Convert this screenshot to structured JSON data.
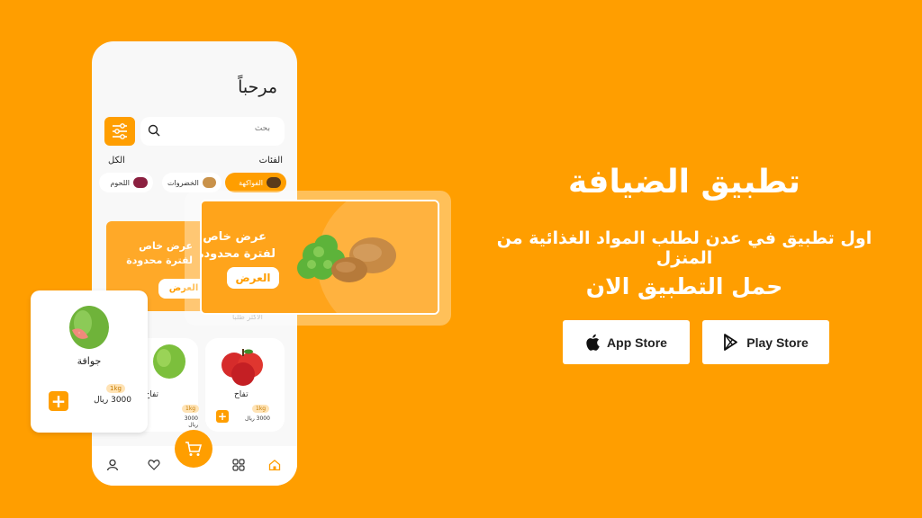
{
  "phone": {
    "greeting": "مرحباً",
    "search_placeholder": "بحث",
    "categories_title": "الفئات",
    "categories_all": "الكل",
    "categories": [
      "الفواكهة",
      "الخضروات",
      "اللحوم"
    ],
    "promo": {
      "line1": "عرض خاص",
      "line2": "لفترة محدودة",
      "button": "العرض"
    },
    "most_requested": "الأكثر طلباً",
    "products": [
      {
        "name": "تفاح",
        "unit": "1kg",
        "price": "3000 ريال"
      },
      {
        "name": "تفاح",
        "unit": "1kg",
        "price": "3000 ريال"
      }
    ]
  },
  "floating_promo": {
    "line1": "عرض خاص",
    "line2": "لفترة محدودة",
    "button": "العرض"
  },
  "floating_product": {
    "name": "جوافة",
    "unit": "1kg",
    "price": "3000 ريال"
  },
  "hero": {
    "title": "تطبيق الضيافة",
    "subtitle": "اول تطبيق في عدن لطلب المواد الغذائية من المنزل",
    "cta": "حمل التطبيق الان"
  },
  "stores": {
    "app_store": "App Store",
    "play_store": "Play Store"
  },
  "colors": {
    "brand": "#FF9E00",
    "white": "#FFFFFF"
  }
}
